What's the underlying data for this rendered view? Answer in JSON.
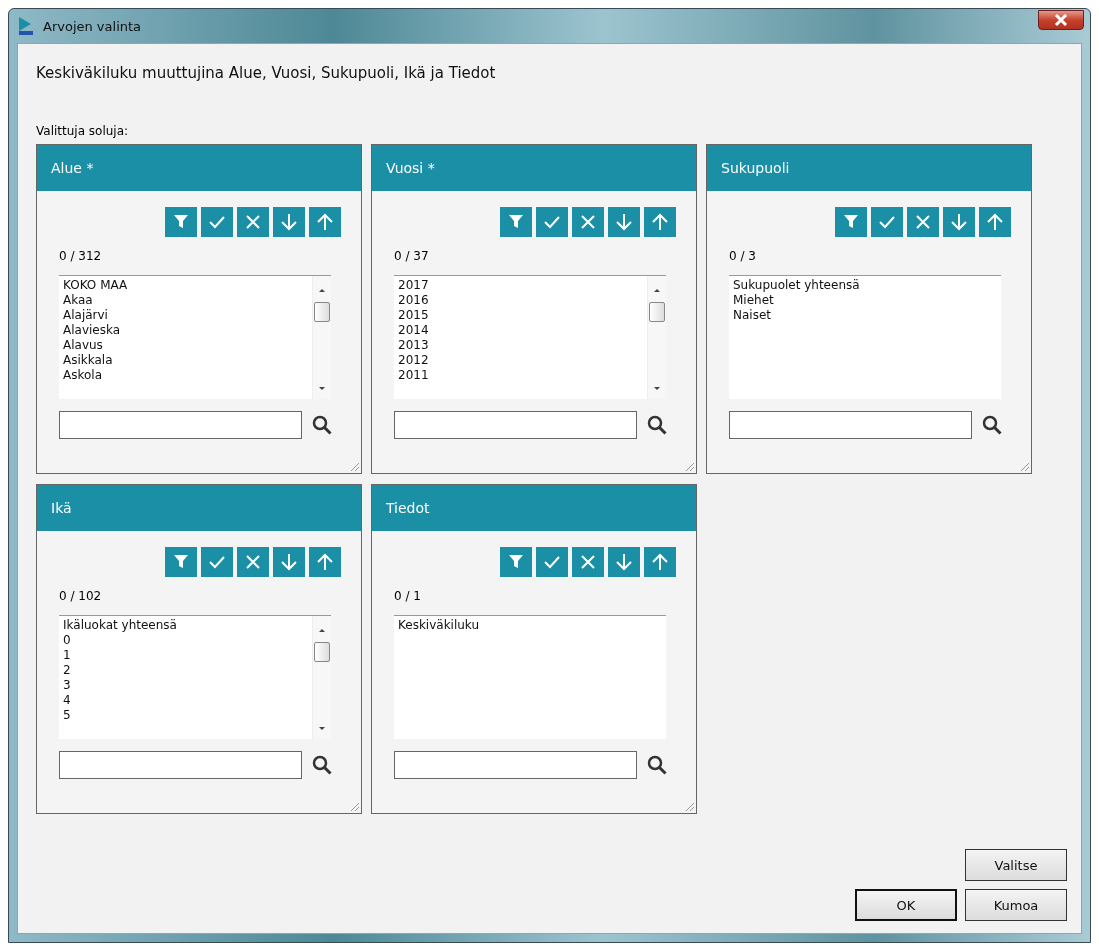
{
  "window": {
    "title": "Arvojen valinta"
  },
  "heading": "Keskiväkiluku muuttujina Alue, Vuosi, Sukupuoli, Ikä ja Tiedot",
  "selected_label": "Valittuja soluja:",
  "panels": [
    {
      "title": "Alue *",
      "count": "0 / 312",
      "scrollable": true,
      "items": [
        "KOKO MAA",
        "Akaa",
        "Alajärvi",
        "Alavieska",
        "Alavus",
        "Asikkala",
        "Askola"
      ]
    },
    {
      "title": "Vuosi *",
      "count": "0 / 37",
      "scrollable": true,
      "items": [
        "2017",
        "2016",
        "2015",
        "2014",
        "2013",
        "2012",
        "2011"
      ]
    },
    {
      "title": "Sukupuoli",
      "count": "0 / 3",
      "scrollable": false,
      "items": [
        "Sukupuolet yhteensä",
        "Miehet",
        "Naiset"
      ]
    },
    {
      "title": "Ikä",
      "count": "0 / 102",
      "scrollable": true,
      "items": [
        "Ikäluokat yhteensä",
        "0",
        "1",
        "2",
        "3",
        "4",
        "5"
      ]
    },
    {
      "title": "Tiedot",
      "count": "0 / 1",
      "scrollable": false,
      "items": [
        "Keskiväkiluku"
      ]
    }
  ],
  "buttons": [
    {
      "label": "Valitse",
      "default": false
    },
    {
      "label": "OK",
      "default": true
    },
    {
      "label": "Kumoa",
      "default": false
    }
  ]
}
